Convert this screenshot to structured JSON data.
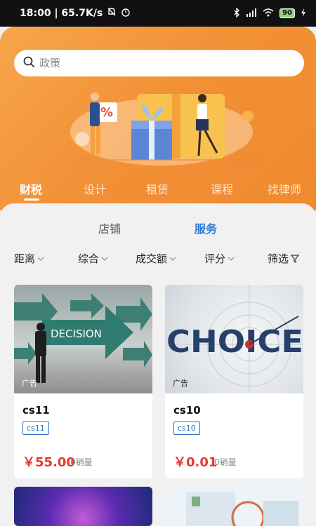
{
  "status_bar": {
    "time_speed": "18:00 | 65.7K/s",
    "battery": "90"
  },
  "search": {
    "placeholder": "政策"
  },
  "categories": [
    "财税",
    "设计",
    "租赁",
    "课程",
    "找律师"
  ],
  "sub_tabs": [
    "店铺",
    "服务"
  ],
  "filters": [
    "距离",
    "综合",
    "成交额",
    "评分",
    "筛选"
  ],
  "cards": [
    {
      "title": "cs11",
      "tag": "cs11",
      "price": "￥55.00",
      "sales": "0销量",
      "ad": "广告",
      "image_text": "DECISION"
    },
    {
      "title": "cs10",
      "tag": "cs10",
      "price": "￥0.01",
      "sales": "0销量",
      "ad": "广告",
      "image_text": "CHOICE"
    }
  ],
  "colors": {
    "accent_orange": "#f29036",
    "active_blue": "#2f78d6",
    "price_red": "#e23b2e"
  },
  "icons": [
    "search-icon",
    "filter-icon",
    "chevron-down-icon"
  ]
}
